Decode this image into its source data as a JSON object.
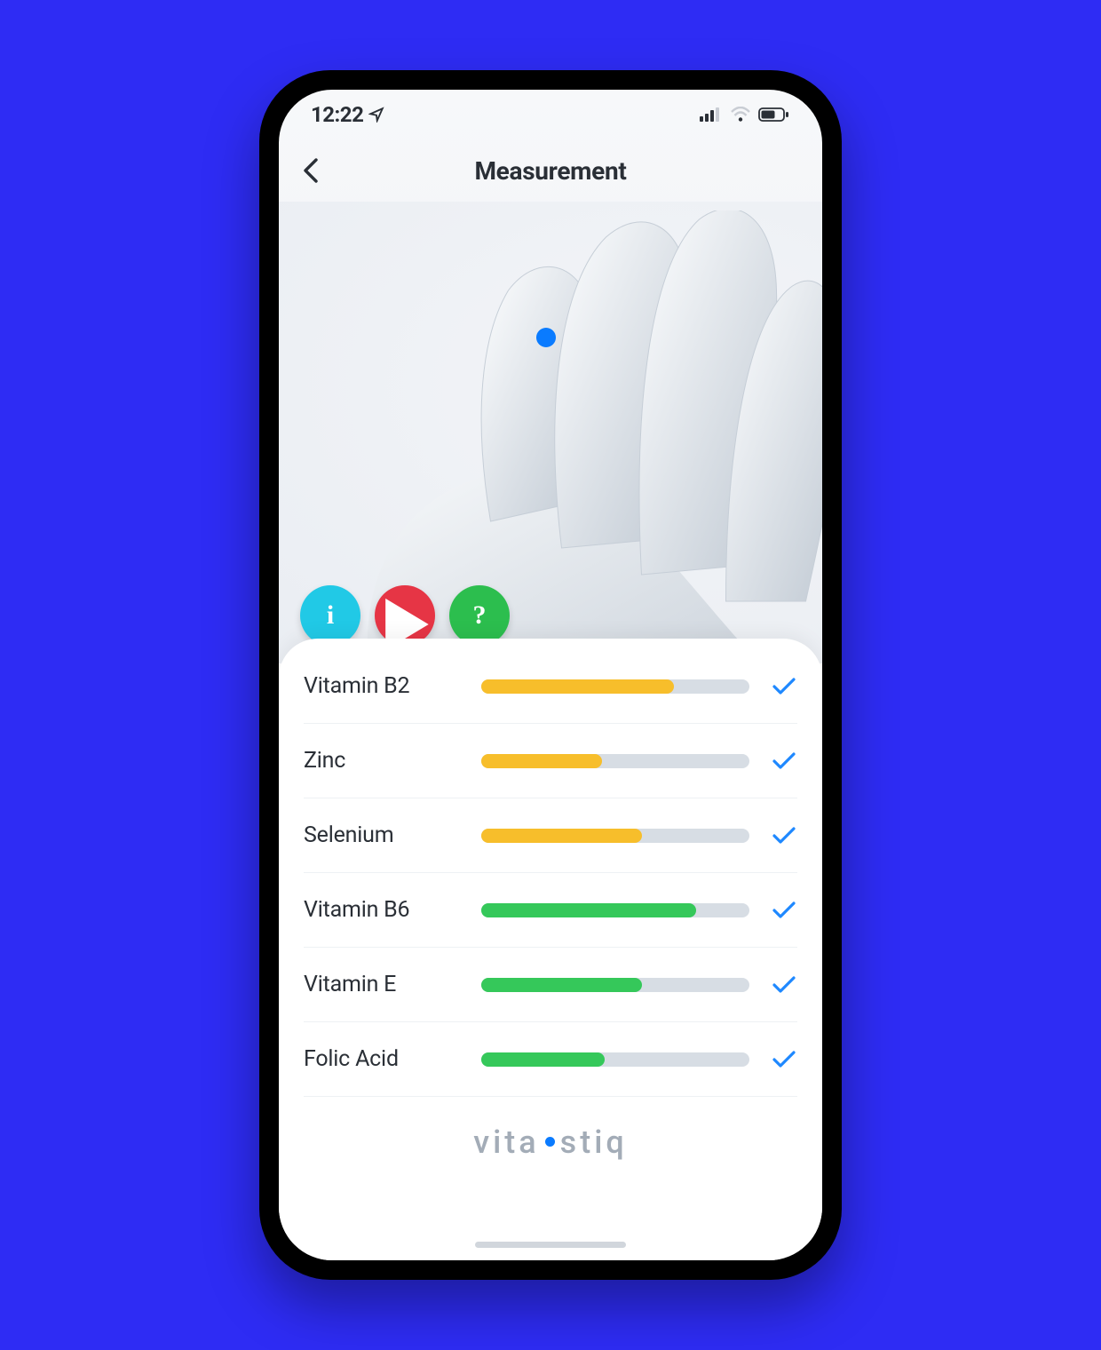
{
  "statusbar": {
    "time": "12:22"
  },
  "navbar": {
    "title": "Measurement"
  },
  "actions": {
    "info_label": "i",
    "help_label": "?"
  },
  "colors": {
    "yellow": "#F7BE2B",
    "green": "#35C85A"
  },
  "items": [
    {
      "label": "Vitamin B2",
      "value": 72,
      "status": "mild",
      "done": true
    },
    {
      "label": "Zinc",
      "value": 45,
      "status": "mild",
      "done": true
    },
    {
      "label": "Selenium",
      "value": 60,
      "status": "mild",
      "done": true
    },
    {
      "label": "Vitamin B6",
      "value": 80,
      "status": "good",
      "done": true
    },
    {
      "label": "Vitamin E",
      "value": 60,
      "status": "good",
      "done": true
    },
    {
      "label": "Folic Acid",
      "value": 46,
      "status": "good",
      "done": true
    }
  ],
  "branding": {
    "left": "vita",
    "right": "stiq"
  }
}
